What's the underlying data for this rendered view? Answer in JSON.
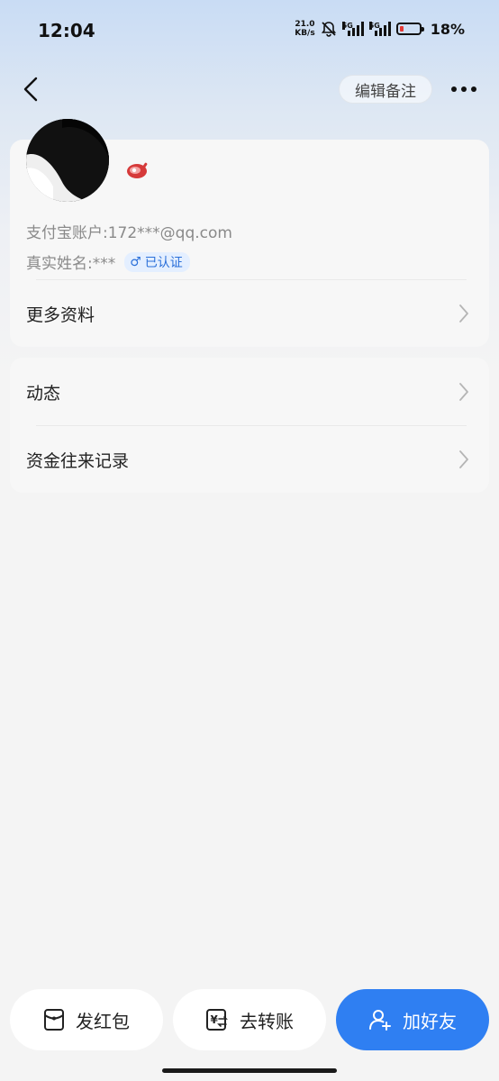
{
  "status_bar": {
    "time": "12:04",
    "net_speed_value": "21.0",
    "net_speed_unit": "KB/s",
    "network1": "5G",
    "network2": "5G",
    "battery_level": 0.18,
    "battery_text": "18%"
  },
  "nav": {
    "back_icon": "back-arrow-icon",
    "remark_label": "编辑备注",
    "more_icon": "more-dots-icon"
  },
  "profile": {
    "badge_icon": "meat-icon",
    "alipay_account": "支付宝账户:172***@qq.com",
    "real_name": "真实姓名:***",
    "gender_symbol": "♂",
    "verified_label": "已认证",
    "more_info_label": "更多资料"
  },
  "links": {
    "moments_label": "动态",
    "records_label": "资金往来记录"
  },
  "bottom": {
    "red_packet_label": "发红包",
    "transfer_label": "去转账",
    "add_friend_label": "加好友"
  },
  "colors": {
    "accent": "#2f7ff2",
    "verified_text": "#2a6fd9",
    "battery_low": "#e53935"
  }
}
